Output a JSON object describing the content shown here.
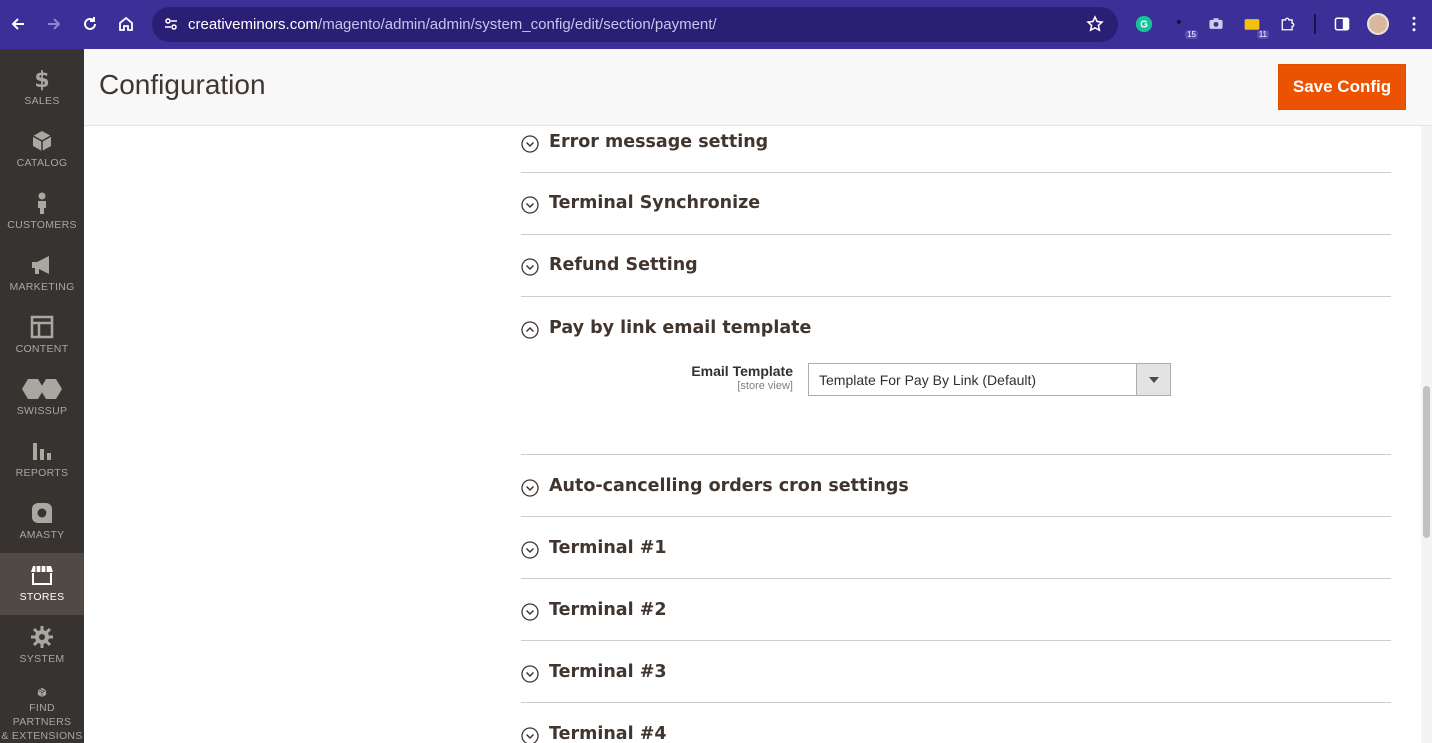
{
  "browser": {
    "url_host": "creativeminors.com",
    "url_path": "/magento/admin/admin/system_config/edit/section/payment/",
    "extensions": [
      {
        "name": "grammarly-icon",
        "badge": ""
      },
      {
        "name": "extension-badge-icon",
        "badge": "15"
      },
      {
        "name": "camera-icon",
        "badge": ""
      },
      {
        "name": "folder-icon",
        "badge": "11"
      },
      {
        "name": "puzzle-icon",
        "badge": ""
      }
    ]
  },
  "admin_nav": {
    "items": [
      {
        "label": "SALES",
        "icon": "dollar-icon"
      },
      {
        "label": "CATALOG",
        "icon": "box-icon"
      },
      {
        "label": "CUSTOMERS",
        "icon": "person-icon"
      },
      {
        "label": "MARKETING",
        "icon": "megaphone-icon"
      },
      {
        "label": "CONTENT",
        "icon": "layout-icon"
      },
      {
        "label": "SWISSUP",
        "icon": "swissup-icon"
      },
      {
        "label": "REPORTS",
        "icon": "bar-chart-icon"
      },
      {
        "label": "AMASTY",
        "icon": "amasty-icon"
      },
      {
        "label": "STORES",
        "icon": "store-icon",
        "active": true
      },
      {
        "label": "SYSTEM",
        "icon": "gear-icon"
      },
      {
        "label": "FIND PARTNERS",
        "label2": "& EXTENSIONS",
        "icon": "partners-box-icon"
      }
    ]
  },
  "header": {
    "title": "Configuration",
    "save_label": "Save Config"
  },
  "sections": [
    {
      "title": "Error message setting",
      "open": false
    },
    {
      "title": "Terminal Synchronize",
      "open": false
    },
    {
      "title": "Refund Setting",
      "open": false
    },
    {
      "title": "Pay by link email template",
      "open": true
    },
    {
      "title": "Auto-cancelling orders cron settings",
      "open": false
    },
    {
      "title": "Terminal #1",
      "open": false
    },
    {
      "title": "Terminal #2",
      "open": false
    },
    {
      "title": "Terminal #3",
      "open": false
    },
    {
      "title": "Terminal #4",
      "open": false
    }
  ],
  "email_template_field": {
    "label": "Email Template",
    "scope": "[store view]",
    "value": "Template For Pay By Link (Default)"
  }
}
